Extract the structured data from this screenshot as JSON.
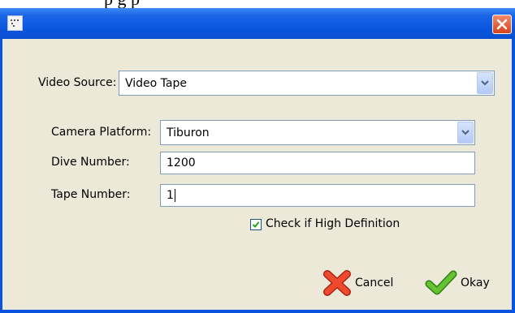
{
  "page_top_text": "p            g            p",
  "dialog": {
    "app_icon": "app-icon",
    "close_icon": "close-x-icon"
  },
  "form": {
    "video_source": {
      "label": "Video Source:",
      "value": "Video Tape"
    },
    "camera_platform": {
      "label": "Camera Platform:",
      "value": "Tiburon"
    },
    "dive_number": {
      "label": "Dive Number:",
      "value": "1200"
    },
    "tape_number": {
      "label": "Tape Number:",
      "value": "1"
    },
    "high_definition": {
      "label": "Check if High Definition",
      "checked": true
    }
  },
  "buttons": {
    "cancel": {
      "label": "Cancel",
      "icon": "red-x-icon"
    },
    "okay": {
      "label": "Okay",
      "icon": "green-check-icon"
    }
  },
  "colors": {
    "titlebar": "#0a55dd",
    "dialog_bg": "#ece9d8",
    "close_button": "#d6421c",
    "cancel_icon": "#e8402a",
    "okay_icon": "#5ab82c"
  }
}
